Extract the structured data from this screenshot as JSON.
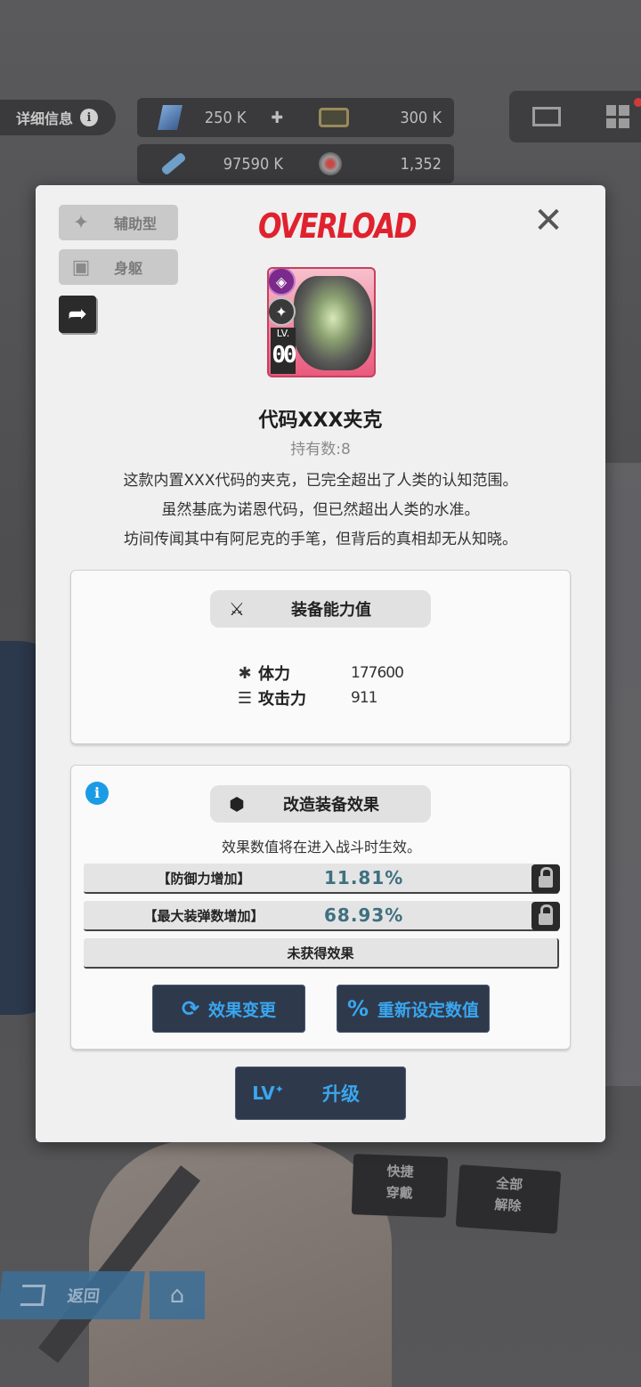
{
  "topbar": {
    "detail_label": "详细信息",
    "resources": {
      "gems": "250 K",
      "tickets": "300 K",
      "feathers": "97590 K",
      "coins": "1,352"
    }
  },
  "background_buttons": {
    "quick_equip": [
      "快捷",
      "穿戴"
    ],
    "unequip_all": [
      "全部",
      "解除"
    ],
    "back": "返回"
  },
  "modal": {
    "tag_type": "辅助型",
    "tag_slot": "身躯",
    "logo": "OVERLOAD",
    "item": {
      "lv_label": "LV.",
      "lv_value": "00",
      "name": "代码XXX夹克",
      "holding": "持有数:8",
      "description": [
        "这款内置XXX代码的夹克，已完全超出了人类的认知范围。",
        "虽然基底为诺恩代码，但已然超出人类的水准。",
        "坊间传闻其中有阿尼克的手笔，但背后的真相却无从知晓。"
      ]
    },
    "stats_panel": {
      "title": "装备能力值",
      "stats": [
        {
          "label": "体力",
          "value": "177600"
        },
        {
          "label": "攻击力",
          "value": "911"
        }
      ]
    },
    "effects_panel": {
      "title": "改造装备效果",
      "note": "效果数值将在进入战斗时生效。",
      "effects": [
        {
          "name": "【防御力增加】",
          "value": "11.81%",
          "locked": true
        },
        {
          "name": "【最大装弹数增加】",
          "value": "68.93%",
          "locked": true
        },
        {
          "name": "未获得效果",
          "value": "",
          "locked": false
        }
      ],
      "change_button": "效果变更",
      "reset_button": "重新设定数值"
    },
    "upgrade": {
      "lv": "LV",
      "label": "升级"
    }
  },
  "colors": {
    "accent_blue": "#3aa6f0",
    "logo_red": "#e0222e",
    "effect_value": "#3f7080",
    "card_pink": "#e85a7e"
  },
  "icons": [
    "info-icon",
    "gem-icon",
    "plus-icon",
    "ticket-icon",
    "feather-icon",
    "coin-icon",
    "mail-icon",
    "grid-menu-icon",
    "support-type-icon",
    "body-slot-icon",
    "share-icon",
    "close-icon",
    "hp-icon",
    "attack-icon",
    "crossed-swords-icon",
    "cube-icon",
    "lock-icon",
    "refresh-icon",
    "percent-icon",
    "home-icon",
    "back-icon"
  ]
}
